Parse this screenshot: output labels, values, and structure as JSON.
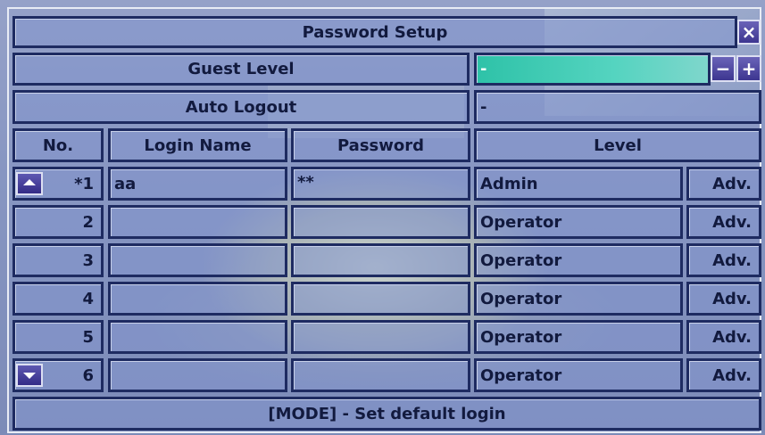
{
  "dialog": {
    "title": "Password Setup",
    "close_symbol": "×"
  },
  "guest_level": {
    "label": "Guest Level",
    "value": "-",
    "minus_symbol": "−",
    "plus_symbol": "+"
  },
  "auto_logout": {
    "label": "Auto Logout",
    "value": "-"
  },
  "table": {
    "headers": [
      "No.",
      "Login Name",
      "Password",
      "Level"
    ],
    "rows": [
      {
        "no": "*1",
        "login": "aa",
        "password": "**",
        "level": "Admin",
        "adv": "Adv."
      },
      {
        "no": "2",
        "login": "",
        "password": "",
        "level": "Operator",
        "adv": "Adv."
      },
      {
        "no": "3",
        "login": "",
        "password": "",
        "level": "Operator",
        "adv": "Adv."
      },
      {
        "no": "4",
        "login": "",
        "password": "",
        "level": "Operator",
        "adv": "Adv."
      },
      {
        "no": "5",
        "login": "",
        "password": "",
        "level": "Operator",
        "adv": "Adv."
      },
      {
        "no": "6",
        "login": "",
        "password": "",
        "level": "Operator",
        "adv": "Adv."
      }
    ]
  },
  "footer": {
    "hint": "[MODE] - Set default login"
  },
  "icons": {
    "scroll_up": "scroll-up-arrow-icon",
    "scroll_down": "scroll-down-arrow-icon",
    "close": "close-icon"
  },
  "colors": {
    "border": "#1e2b61",
    "cell_fill": "#8496ce",
    "highlight": "#2ec2a8",
    "button": "#4a43a0"
  }
}
